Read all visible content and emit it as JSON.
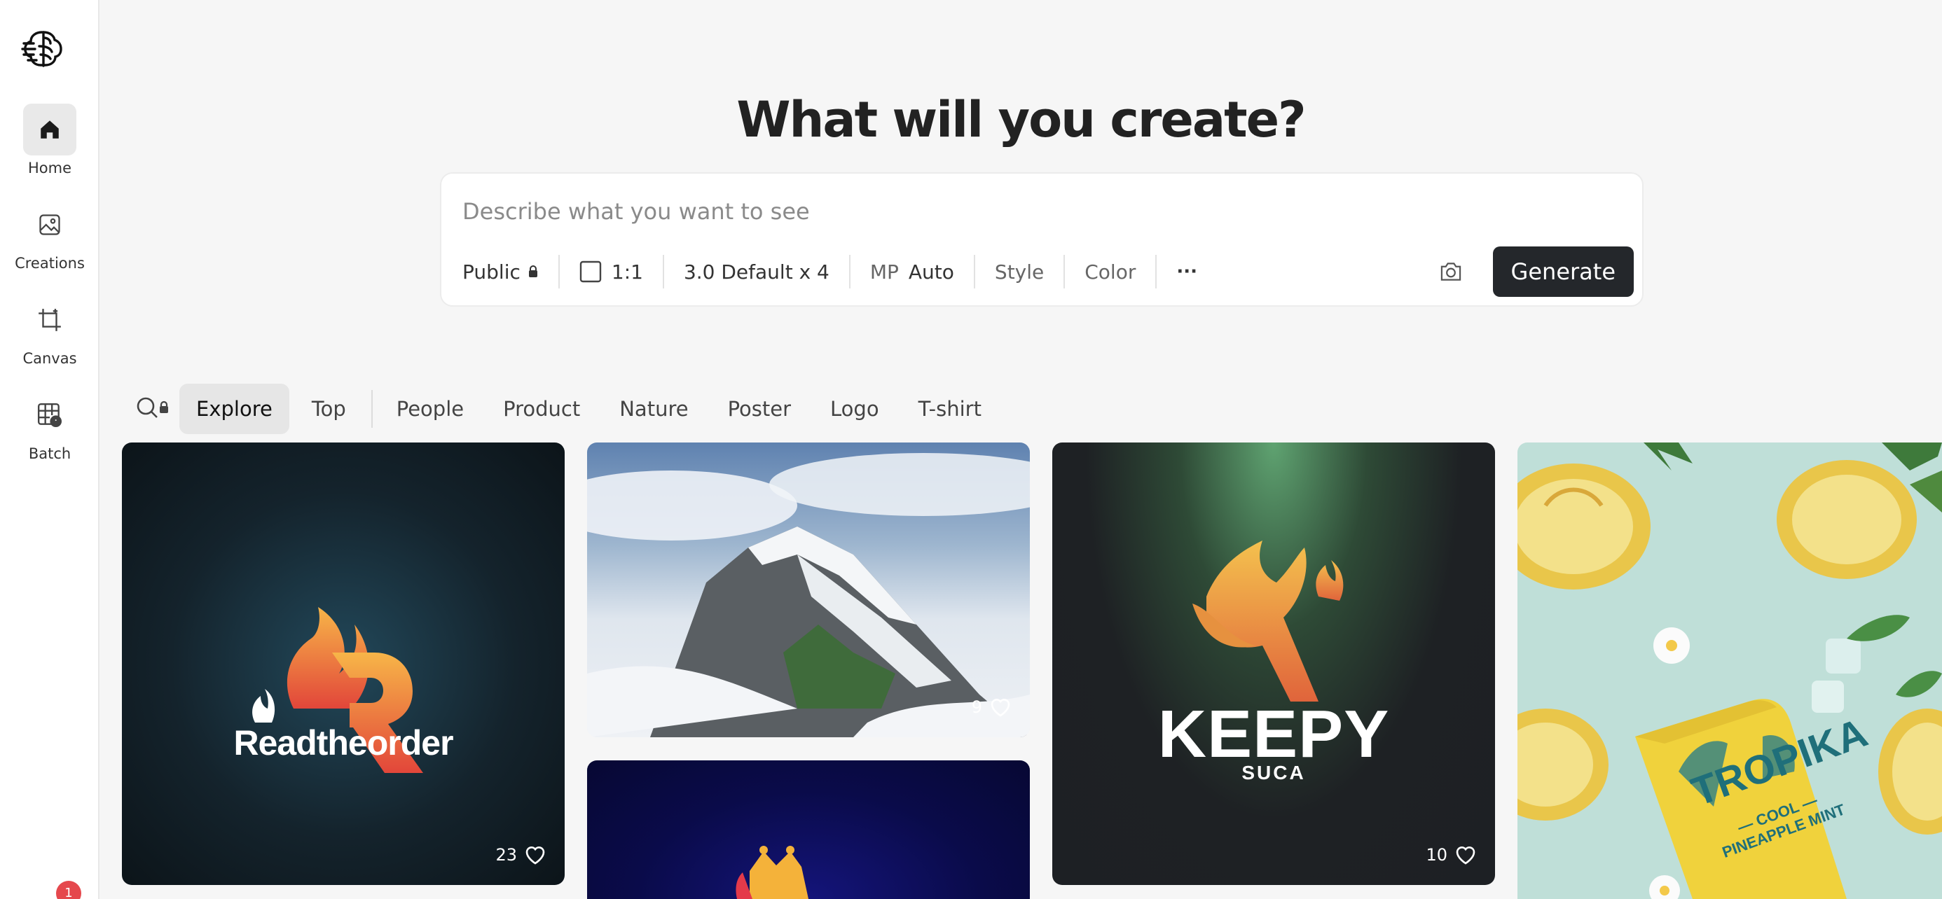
{
  "sidebar": {
    "items": [
      {
        "label": "Home",
        "icon": "home-icon",
        "active": true
      },
      {
        "label": "Creations",
        "icon": "image-icon",
        "active": false
      },
      {
        "label": "Canvas",
        "icon": "crop-icon",
        "active": false
      },
      {
        "label": "Batch",
        "icon": "batch-icon",
        "active": false
      }
    ],
    "notification_count": "1"
  },
  "hero": {
    "title": "What will you create?"
  },
  "prompt": {
    "placeholder": "Describe what you want to see",
    "visibility": "Public",
    "aspect_ratio": "1:1",
    "model": "3.0 Default x 4",
    "mp_label": "MP",
    "mp_value": "Auto",
    "style_label": "Style",
    "color_label": "Color",
    "more_label": "···",
    "generate_label": "Generate"
  },
  "filters": {
    "tabs": [
      "Explore",
      "Top",
      "People",
      "Product",
      "Nature",
      "Poster",
      "Logo",
      "T-shirt"
    ],
    "active": "Explore"
  },
  "gallery": {
    "cards": [
      {
        "title": "Readtheorder",
        "likes": "23"
      },
      {
        "title": "",
        "likes": "9"
      },
      {
        "title": "KEEPY",
        "subtitle": "SUCA",
        "likes": "10"
      },
      {
        "title": "TROPIKA",
        "subtitle": "— COOL —\nPINEAPPLE MINT"
      },
      {
        "title": ""
      }
    ]
  },
  "colors": {
    "accent_dark": "#24272b",
    "badge": "#e5484d",
    "background": "#f6f6f6"
  }
}
